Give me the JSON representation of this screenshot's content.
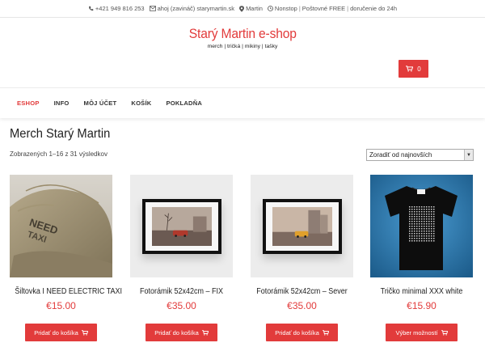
{
  "topbar": {
    "phone": "+421 949 816 253",
    "email": "ahoj (zavináč) starymartin.sk",
    "location": "Martin",
    "hours": "Nonstop",
    "shipping": "Poštovné FREE",
    "delivery": "doručenie do 24h"
  },
  "brand": {
    "title": "Starý Martin e-shop",
    "tagline": "merch | tričká | mikiny | tašky"
  },
  "cart": {
    "count": "0"
  },
  "nav": [
    "ESHOP",
    "INFO",
    "MÔJ ÚČET",
    "KOŠÍK",
    "POKLADŇA"
  ],
  "page": {
    "title": "Merch Starý Martin",
    "result_count": "Zobrazených 1–16 z 31 výsledkov",
    "sort_selected": "Zoradiť od najnovších"
  },
  "products": [
    {
      "name": "Šiltovka I NEED ELECTRIC TAXI",
      "price": "€15.00",
      "button": "Pridať do košíka"
    },
    {
      "name": "Fotorámik 52x42cm – FIX",
      "price": "€35.00",
      "button": "Pridať do košíka"
    },
    {
      "name": "Fotorámik 52x42cm – Sever",
      "price": "€35.00",
      "button": "Pridať do košíka"
    },
    {
      "name": "Tričko minimal XXX white",
      "price": "€15.90",
      "button": "Výber možností"
    }
  ],
  "colors": {
    "accent": "#e23b3b"
  },
  "icons": [
    "phone-icon",
    "envelope-icon",
    "map-pin-icon",
    "clock-icon",
    "cart-icon"
  ]
}
